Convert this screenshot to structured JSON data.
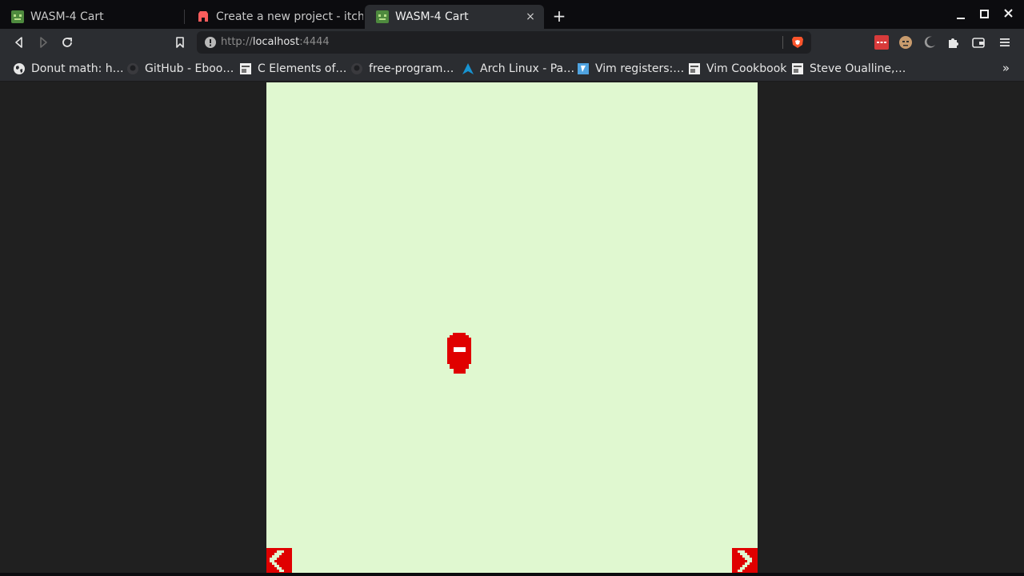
{
  "tabs": [
    {
      "title": "WASM-4 Cart",
      "favicon": "wasm4-icon",
      "active": false
    },
    {
      "title": "Create a new project - itch.io",
      "favicon": "itchio-icon",
      "active": false
    },
    {
      "title": "WASM-4 Cart",
      "favicon": "wasm4-icon",
      "active": true,
      "close": "×"
    }
  ],
  "new_tab_label": "+",
  "address_bar": {
    "scheme": "http://",
    "host": "localhost",
    "port": ":4444"
  },
  "bookmarks": [
    {
      "label": "Donut math: h…",
      "icon": "globe-icon"
    },
    {
      "label": "GitHub - Eboo…",
      "icon": "github-icon"
    },
    {
      "label": "C Elements of…",
      "icon": "page-icon"
    },
    {
      "label": "free-program…",
      "icon": "github-icon"
    },
    {
      "label": "Arch Linux - Pa…",
      "icon": "arch-icon"
    },
    {
      "label": "Vim registers:…",
      "icon": "vim-icon"
    },
    {
      "label": "Vim Cookbook",
      "icon": "page-icon"
    },
    {
      "label": "Steve Oualline,…",
      "icon": "page-icon"
    }
  ],
  "bookmarks_overflow": "»",
  "game": {
    "background_color": "#e0f8d0",
    "sprite_color": "#e00000",
    "left_arrow": "chevron-left-icon",
    "right_arrow": "chevron-right-icon"
  },
  "colors": {
    "chrome_dark": "#0c0c0f",
    "toolbar": "#2b2d31",
    "brave_orange": "#fb542b"
  }
}
